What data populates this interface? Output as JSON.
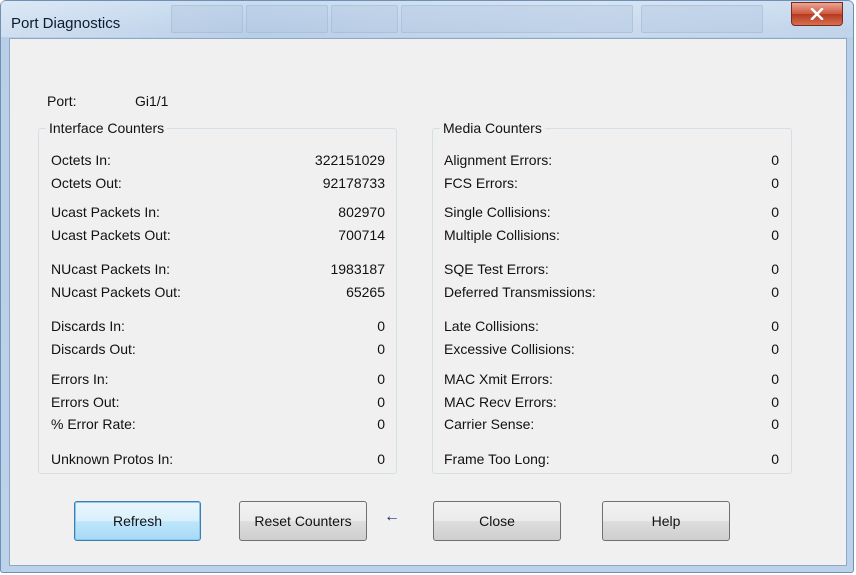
{
  "window": {
    "title": "Port Diagnostics"
  },
  "port": {
    "label": "Port:",
    "value": "Gi1/1"
  },
  "interface": {
    "title": "Interface Counters",
    "rows": [
      {
        "label": "Octets In:",
        "value": "322151029"
      },
      {
        "label": "Octets Out:",
        "value": "92178733"
      },
      {
        "label": "Ucast Packets In:",
        "value": "802970"
      },
      {
        "label": "Ucast Packets Out:",
        "value": "700714"
      },
      {
        "label": "NUcast Packets In:",
        "value": "1983187"
      },
      {
        "label": "NUcast Packets Out:",
        "value": "65265"
      },
      {
        "label": "Discards In:",
        "value": "0"
      },
      {
        "label": "Discards Out:",
        "value": "0"
      },
      {
        "label": "Errors In:",
        "value": "0"
      },
      {
        "label": "Errors Out:",
        "value": "0"
      },
      {
        "label": "% Error Rate:",
        "value": "0"
      },
      {
        "label": "Unknown Protos In:",
        "value": "0"
      }
    ]
  },
  "media": {
    "title": "Media Counters",
    "rows": [
      {
        "label": "Alignment Errors:",
        "value": "0"
      },
      {
        "label": "FCS Errors:",
        "value": "0"
      },
      {
        "label": "Single Collisions:",
        "value": "0"
      },
      {
        "label": "Multiple Collisions:",
        "value": "0"
      },
      {
        "label": "SQE Test Errors:",
        "value": "0"
      },
      {
        "label": "Deferred Transmissions:",
        "value": "0"
      },
      {
        "label": "Late Collisions:",
        "value": "0"
      },
      {
        "label": "Excessive Collisions:",
        "value": "0"
      },
      {
        "label": "MAC Xmit Errors:",
        "value": "0"
      },
      {
        "label": "MAC Recv Errors:",
        "value": "0"
      },
      {
        "label": "Carrier Sense:",
        "value": "0"
      },
      {
        "label": "Frame Too Long:",
        "value": "0"
      }
    ]
  },
  "buttons": {
    "refresh": "Refresh",
    "reset": "Reset Counters",
    "close": "Close",
    "help": "Help"
  },
  "icons": {
    "close": "close-icon",
    "arrow": "left-arrow-icon"
  },
  "colors": {
    "title_bar": "#bcd1ea",
    "close_button": "#c9462d",
    "default_button_border": "#3c7fb1",
    "dialog_background": "#f0f0f0"
  }
}
